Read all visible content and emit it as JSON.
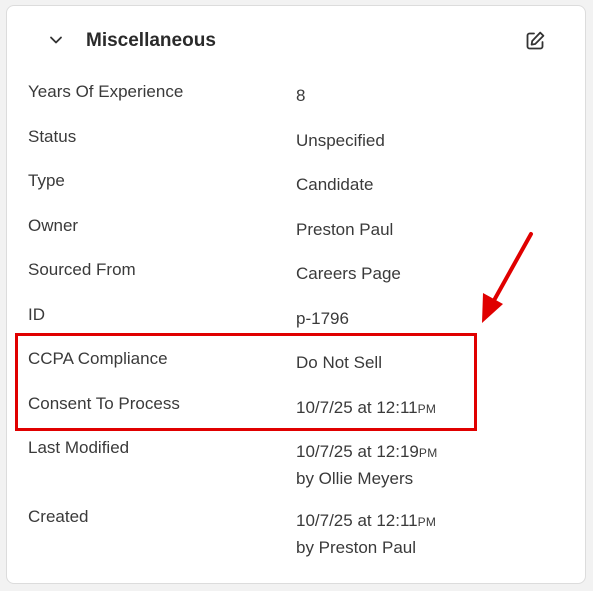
{
  "section": {
    "title": "Miscellaneous"
  },
  "fields": [
    {
      "label": "Years Of Experience",
      "value": "8"
    },
    {
      "label": "Status",
      "value": "Unspecified"
    },
    {
      "label": "Type",
      "value": "Candidate"
    },
    {
      "label": "Owner",
      "value": "Preston Paul"
    },
    {
      "label": "Sourced From",
      "value": "Careers Page"
    },
    {
      "label": "ID",
      "value": "p-1796"
    },
    {
      "label": "CCPA Compliance",
      "value": "Do Not Sell"
    },
    {
      "label": "Consent To Process",
      "value": "10/7/25 at 12:11",
      "ampm": "PM"
    },
    {
      "label": "Last Modified",
      "value": "10/7/25 at 12:19",
      "ampm": "PM",
      "by": "by Ollie Meyers"
    },
    {
      "label": "Created",
      "value": "10/7/25 at 12:11",
      "ampm": "PM",
      "by": "by Preston Paul"
    }
  ],
  "icons": {
    "collapse": "chevron-down-icon",
    "edit": "edit-icon"
  },
  "colors": {
    "highlight": "#e00000",
    "arrow": "#e00000"
  }
}
